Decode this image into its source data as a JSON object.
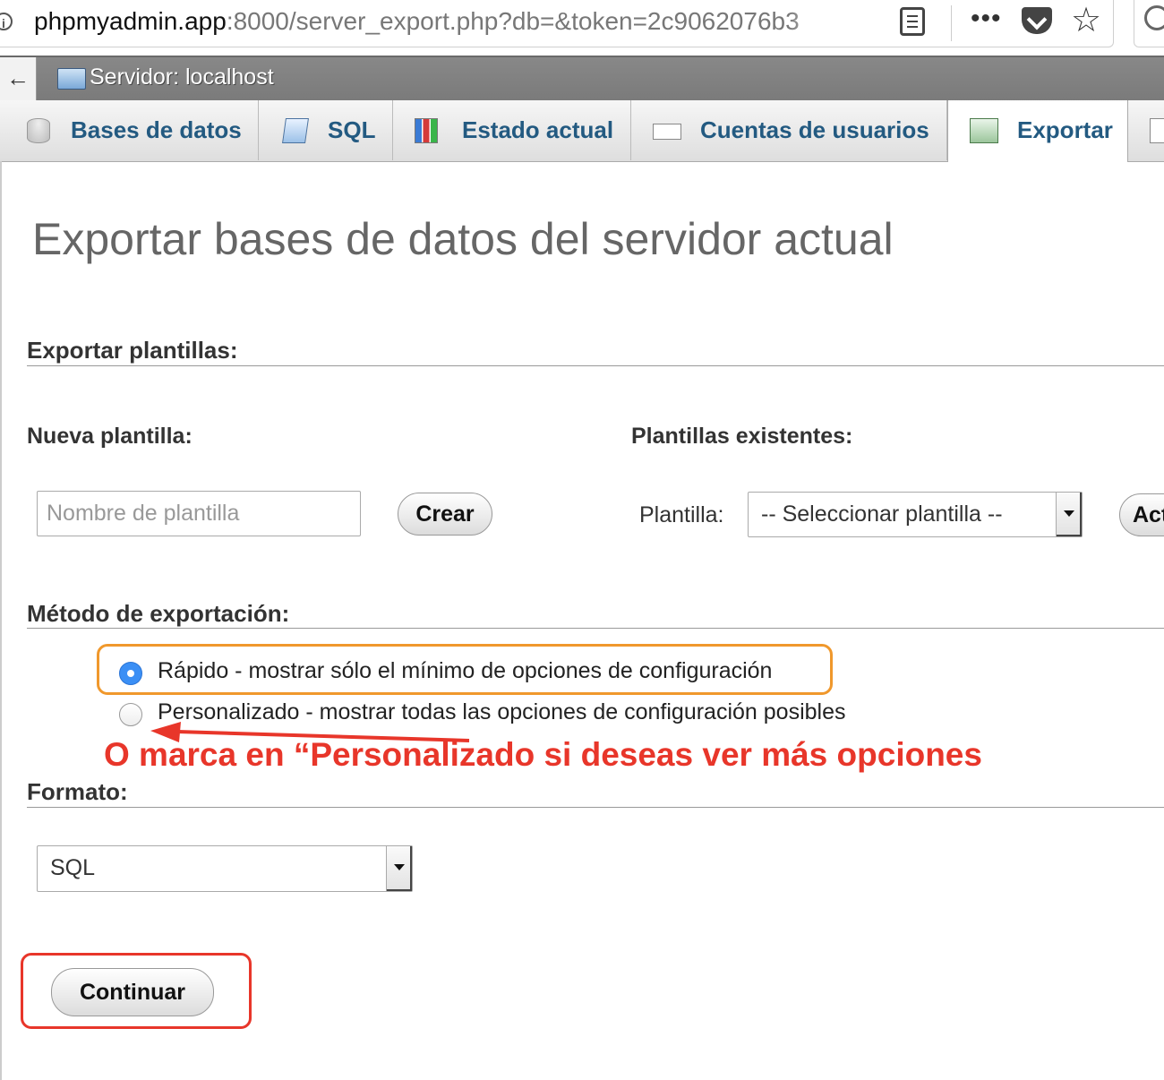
{
  "browser": {
    "url_host": "phpmyadmin.app",
    "url_rest": ":8000/server_export.php?db=&token=2c9062076b3",
    "more_label": "•••",
    "star_label": "☆"
  },
  "server": {
    "back_label": "←",
    "title": "Servidor: localhost"
  },
  "tabs": [
    {
      "label": "Bases de datos"
    },
    {
      "label": "SQL"
    },
    {
      "label": "Estado actual"
    },
    {
      "label": "Cuentas de usuarios"
    },
    {
      "label": "Exportar",
      "active": true
    },
    {
      "label": ""
    }
  ],
  "page": {
    "title": "Exportar bases de datos del servidor actual"
  },
  "templates": {
    "heading": "Exportar plantillas:",
    "new_label": "Nueva plantilla:",
    "name_placeholder": "Nombre de plantilla",
    "create_label": "Crear",
    "existing_label": "Plantillas existentes:",
    "template_label": "Plantilla:",
    "template_selected": "-- Seleccionar plantilla --",
    "update_label": "Actualizar"
  },
  "method": {
    "heading": "Método de exportación:",
    "quick_label": "Rápido - mostrar sólo el mínimo de opciones de configuración",
    "custom_label": "Personalizado - mostrar todas las opciones de configuración posibles",
    "selected": "quick"
  },
  "annotation": {
    "text": "O marca en “Personalizado si deseas ver más opciones",
    "color": "#e8362a",
    "highlight_color": "#f0982c"
  },
  "format": {
    "heading": "Formato:",
    "selected": "SQL"
  },
  "actions": {
    "continue_label": "Continuar"
  }
}
